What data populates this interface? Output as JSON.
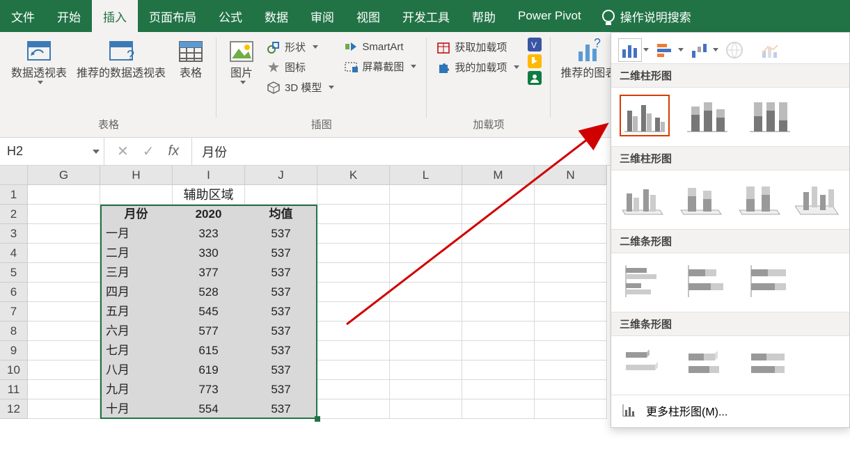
{
  "tabs": {
    "file": "文件",
    "home": "开始",
    "insert": "插入",
    "page_layout": "页面布局",
    "formulas": "公式",
    "data": "数据",
    "review": "审阅",
    "view": "视图",
    "developer": "开发工具",
    "help": "帮助",
    "power_pivot": "Power Pivot",
    "tell_me": "操作说明搜索"
  },
  "ribbon": {
    "pivot": "数据透视表",
    "rec_pivot": "推荐的数据透视表",
    "table": "表格",
    "group_tables": "表格",
    "pictures": "图片",
    "shapes": "形状",
    "icons": "图标",
    "model3d": "3D 模型",
    "smartart": "SmartArt",
    "screenshot": "屏幕截图",
    "group_illust": "插图",
    "get_addins": "获取加载项",
    "my_addins": "我的加载项",
    "group_addins": "加载项",
    "rec_charts": "推荐的图表"
  },
  "chart_panel": {
    "sec_col2d": "二维柱形图",
    "sec_col3d": "三维柱形图",
    "sec_bar2d": "二维条形图",
    "sec_bar3d": "三维条形图",
    "more": "更多柱形图(M)..."
  },
  "formula_bar": {
    "name": "H2",
    "fx": "fx",
    "value": "月份"
  },
  "columns": [
    "G",
    "H",
    "I",
    "J",
    "K",
    "L",
    "M",
    "N"
  ],
  "sheet": {
    "title_cell": "辅助区域",
    "headers": {
      "h": "月份",
      "i": "2020",
      "j": "均值"
    },
    "rows": [
      {
        "m": "一月",
        "v": "323",
        "a": "537"
      },
      {
        "m": "二月",
        "v": "330",
        "a": "537"
      },
      {
        "m": "三月",
        "v": "377",
        "a": "537"
      },
      {
        "m": "四月",
        "v": "528",
        "a": "537"
      },
      {
        "m": "五月",
        "v": "545",
        "a": "537"
      },
      {
        "m": "六月",
        "v": "577",
        "a": "537"
      },
      {
        "m": "七月",
        "v": "615",
        "a": "537"
      },
      {
        "m": "八月",
        "v": "619",
        "a": "537"
      },
      {
        "m": "九月",
        "v": "773",
        "a": "537"
      },
      {
        "m": "十月",
        "v": "554",
        "a": "537"
      }
    ]
  },
  "chart_data": {
    "type": "table",
    "title": "辅助区域",
    "columns": [
      "月份",
      "2020",
      "均值"
    ],
    "categories": [
      "一月",
      "二月",
      "三月",
      "四月",
      "五月",
      "六月",
      "七月",
      "八月",
      "九月",
      "十月"
    ],
    "series": [
      {
        "name": "2020",
        "values": [
          323,
          330,
          377,
          528,
          545,
          577,
          615,
          619,
          773,
          554
        ]
      },
      {
        "name": "均值",
        "values": [
          537,
          537,
          537,
          537,
          537,
          537,
          537,
          537,
          537,
          537
        ]
      }
    ]
  }
}
